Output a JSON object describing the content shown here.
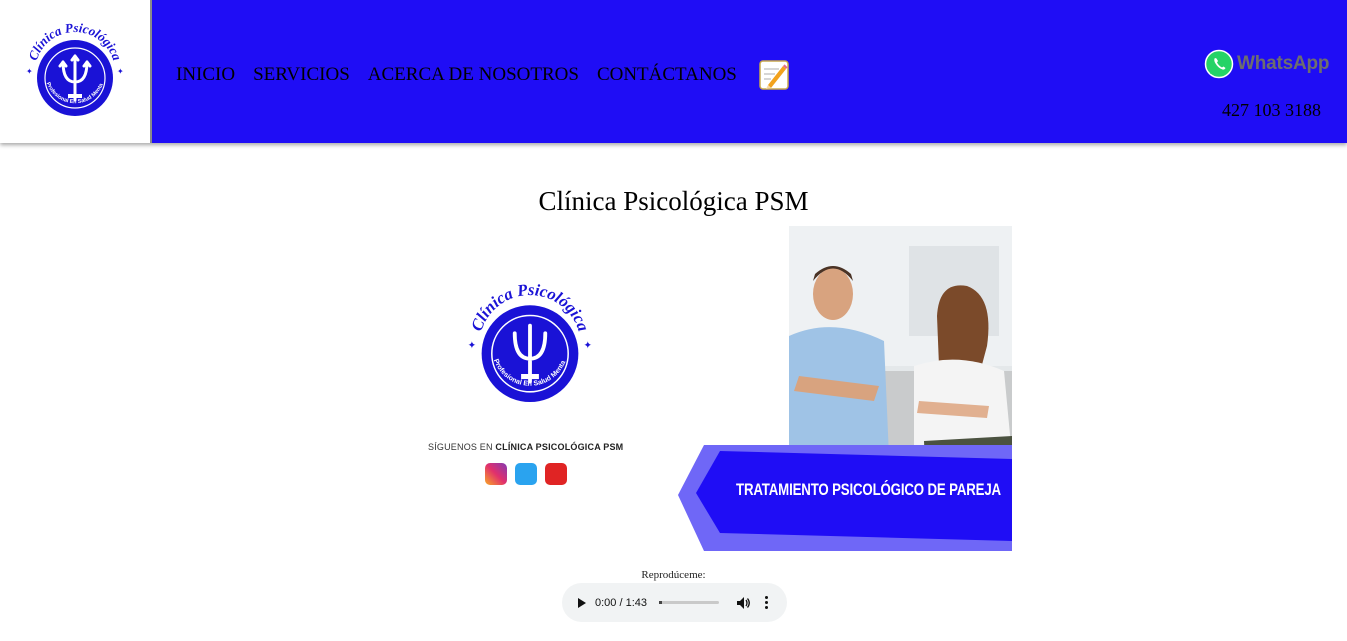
{
  "header": {
    "logo": {
      "arc_text": "Clínica Psicológica",
      "inner_text": "Profesional En Salud Mental"
    },
    "nav": [
      {
        "label": "INICIO"
      },
      {
        "label": "SERVICIOS"
      },
      {
        "label": "ACERCA DE NOSOTROS"
      },
      {
        "label": "CONTÁCTANOS"
      }
    ],
    "edit_icon": "memo-pencil-icon",
    "whatsapp_label": "WhatsApp",
    "phone": "427 103 3188"
  },
  "main": {
    "title": "Clínica Psicológica PSM",
    "banner": {
      "follow_prefix": "SÍGUENOS EN",
      "follow_brand": "CLÍNICA PSICOLÓGICA PSM",
      "socials": [
        "instagram-icon",
        "twitter-icon",
        "youtube-icon"
      ],
      "ribbon_text": "TRATAMIENTO PSICOLÓGICO DE PAREJA"
    },
    "audio": {
      "label": "Reprodúceme:",
      "time": "0:00 / 1:43",
      "progress": 0
    }
  },
  "colors": {
    "header_bg": "#1f0df5",
    "logo_blue": "#1a12d6",
    "whatsapp_green": "#25d366"
  }
}
